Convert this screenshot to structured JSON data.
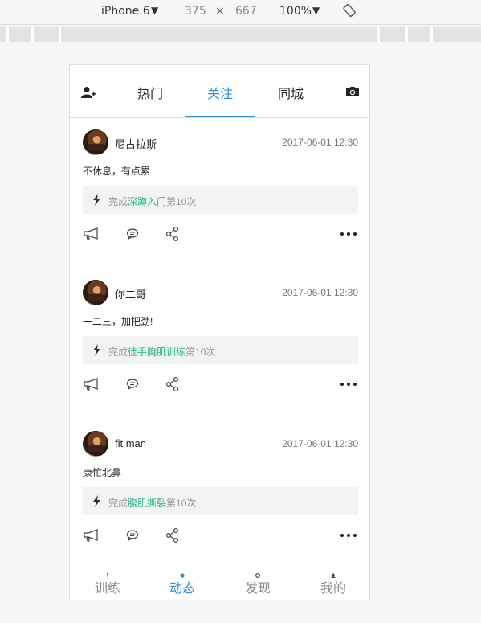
{
  "devtools": {
    "device": "iPhone 6",
    "width": "375",
    "times": "×",
    "height": "667",
    "zoom": "100%"
  },
  "topnav": {
    "tabs": [
      {
        "label": "热门"
      },
      {
        "label": "关注",
        "active": true
      },
      {
        "label": "同城"
      }
    ],
    "left_icon": "add-user-icon",
    "right_icon": "camera-icon"
  },
  "posts": [
    {
      "user": "尼古拉斯",
      "time": "2017-06-01 12:30",
      "content": "不休息，有点累",
      "achieve_prefix": "完成",
      "course": "深蹲入门",
      "achieve_suffix": "第10次"
    },
    {
      "user": "你二哥",
      "time": "2017-06-01 12:30",
      "content": "一二三，加把劲!",
      "achieve_prefix": "完成",
      "course": "徒手胸肌训练",
      "achieve_suffix": "第10次"
    },
    {
      "user": "fit man",
      "time": "2017-06-01 12:30",
      "content": "康忙北鼻",
      "achieve_prefix": "完成",
      "course": "腹肌撕裂",
      "achieve_suffix": "第10次"
    }
  ],
  "bottomnav": {
    "items": [
      {
        "label": "训练"
      },
      {
        "label": "动态",
        "active": true
      },
      {
        "label": "发现"
      },
      {
        "label": "我的"
      }
    ]
  },
  "colors": {
    "accent": "#2e8fd0",
    "course": "#2db78a"
  }
}
